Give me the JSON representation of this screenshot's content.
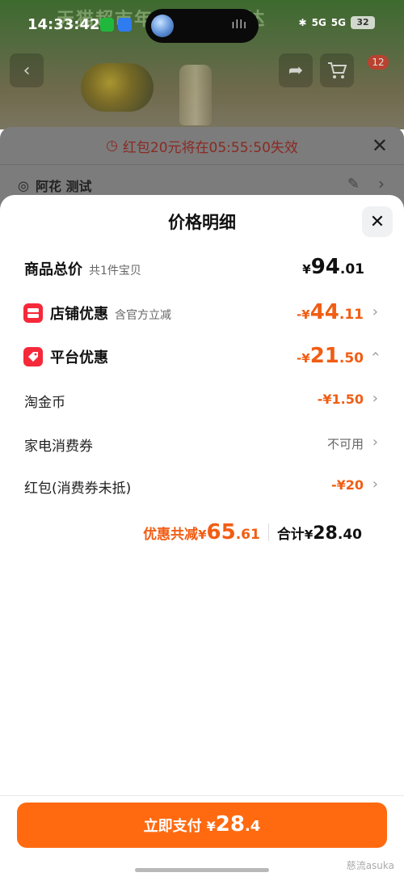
{
  "status_bar": {
    "time": "14:33:42",
    "network_1": "5G",
    "network_2": "5G",
    "battery": "32"
  },
  "background_page": {
    "banner_text": "天猫超市年 品 极速送达",
    "cart_badge": "12"
  },
  "under_sheet": {
    "countdown_text": "红包20元将在05:55:50失效",
    "address_text": "阿花 测试"
  },
  "sheet": {
    "title": "价格明细",
    "rows": {
      "total": {
        "label": "商品总价",
        "sub": "共1件宝贝",
        "symbol": "¥",
        "int": "94",
        "dec": ".01"
      },
      "store": {
        "label": "店铺优惠",
        "sub": "含官方立减",
        "prefix": "-¥",
        "int": "44",
        "dec": ".11"
      },
      "platform": {
        "label": "平台优惠",
        "prefix": "-¥",
        "int": "21",
        "dec": ".50"
      },
      "taojinbi": {
        "label": "淘金币",
        "value": "-¥1.50"
      },
      "appliance": {
        "label": "家电消费券",
        "value": "不可用"
      },
      "hongbao": {
        "label": "红包(消费券未抵)",
        "value": "-¥20"
      }
    },
    "summary": {
      "discount_label": "优惠共减",
      "discount_symbol": "¥",
      "discount_int": "65",
      "discount_dec": ".61",
      "total_label": "合计",
      "total_symbol": "¥",
      "total_int": "28",
      "total_dec": ".40"
    },
    "pay_button": {
      "label": "立即支付",
      "symbol": "¥",
      "int": "28",
      "dec": ".4"
    }
  },
  "watermark": "慈流asuka",
  "colors": {
    "accent_orange": "#ff6a10",
    "discount_orange": "#f15d14",
    "icon_red": "#f5293a"
  }
}
